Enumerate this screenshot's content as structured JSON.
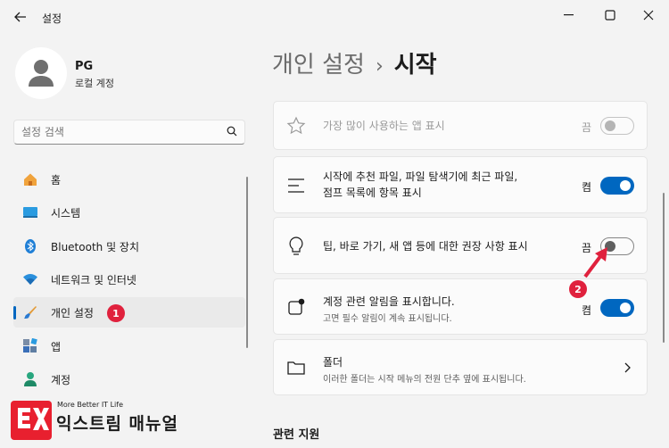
{
  "window": {
    "title": "설정"
  },
  "user": {
    "name": "PG",
    "account_type": "로컬 계정"
  },
  "search": {
    "placeholder": "설정 검색"
  },
  "sidebar": {
    "items": [
      {
        "label": "홈",
        "icon": "home-icon"
      },
      {
        "label": "시스템",
        "icon": "system-icon"
      },
      {
        "label": "Bluetooth 및 장치",
        "icon": "bluetooth-icon"
      },
      {
        "label": "네트워크 및 인터넷",
        "icon": "wifi-icon"
      },
      {
        "label": "개인 설정",
        "icon": "personalization-brush-icon",
        "active": true
      },
      {
        "label": "앱",
        "icon": "apps-icon"
      },
      {
        "label": "계정",
        "icon": "account-icon"
      }
    ]
  },
  "breadcrumb": {
    "parent": "개인 설정",
    "separator": "›",
    "current": "시작"
  },
  "settings": [
    {
      "title": "가장 많이 사용하는 앱 표시",
      "state": "끔",
      "on": false,
      "disabled": true,
      "icon": "star-icon"
    },
    {
      "title": "시작에 추천 파일, 파일 탐색기에 최근 파일,",
      "title2": "점프 목록에 항목 표시",
      "state": "켬",
      "on": true,
      "icon": "list-icon"
    },
    {
      "title": "팁, 바로 가기, 새 앱 등에 대한 권장 사항 표시",
      "state": "끔",
      "on": false,
      "icon": "lightbulb-icon"
    },
    {
      "title": "계정 관련 알림을 표시합니다.",
      "subtitle": "고면 필수 알림이 계속 표시됩니다.",
      "state": "켬",
      "on": true,
      "icon": "notification-icon"
    },
    {
      "title": "폴더",
      "subtitle": "이러한 폴더는 시작 메뉴의 전원 단추 옆에 표시됩니다.",
      "icon": "folder-icon"
    }
  ],
  "related": {
    "heading": "관련 지원"
  },
  "annotations": {
    "badge1": "1",
    "badge2": "2"
  },
  "watermark": {
    "tagline": "More Better IT Life",
    "brand": "익스트림 매뉴얼",
    "logo_letters": "EX"
  },
  "colors": {
    "accent": "#0067c0",
    "badge": "#e0213d",
    "logo": "#e8202f"
  }
}
